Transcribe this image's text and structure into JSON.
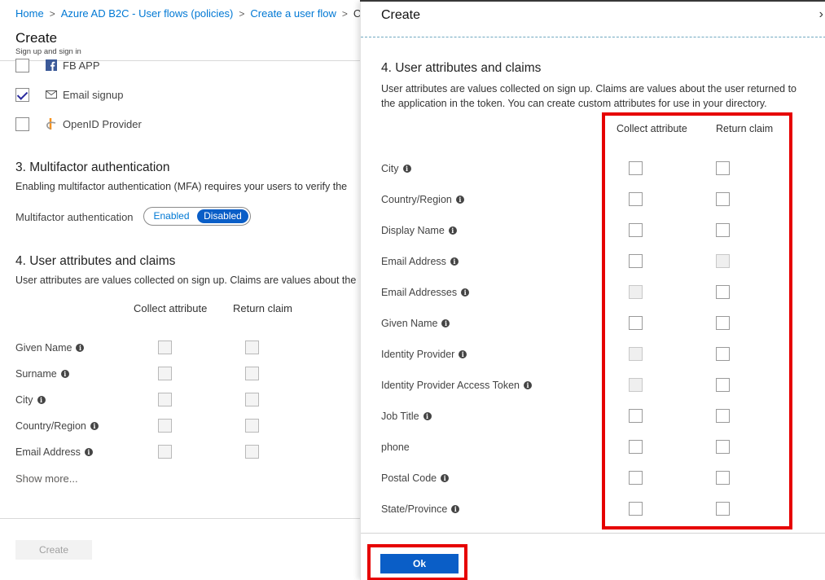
{
  "breadcrumb": {
    "items": [
      "Home",
      "Azure AD B2C - User flows (policies)",
      "Create a user flow",
      "Cre"
    ],
    "separator": ">"
  },
  "blade": {
    "title": "Create",
    "subtitle": "Sign up and sign in"
  },
  "identity_providers": [
    {
      "label": "FB APP",
      "checked": false,
      "icon": "facebook-icon"
    },
    {
      "label": "Email signup",
      "checked": true,
      "icon": "mail-icon"
    },
    {
      "label": "OpenID Provider",
      "checked": false,
      "icon": "openid-icon"
    }
  ],
  "mfa": {
    "heading": "3. Multifactor authentication",
    "description": "Enabling multifactor authentication (MFA) requires your users to verify the",
    "label": "Multifactor authentication",
    "options": [
      "Enabled",
      "Disabled"
    ],
    "selected": "Disabled"
  },
  "left_claims": {
    "heading": "4. User attributes and claims",
    "description": "User attributes are values collected on sign up. Claims are values about the",
    "collect_header": "Collect attribute",
    "return_header": "Return claim",
    "attributes": [
      "Given Name",
      "Surname",
      "City",
      "Country/Region",
      "Email Address"
    ],
    "show_more": "Show more...",
    "create_button": "Create"
  },
  "panel": {
    "title": "Create",
    "close_glyph": "›",
    "section_heading": "4. User attributes and claims",
    "description": "User attributes are values collected on sign up. Claims are values about the user returned to the application in the token. You can create custom attributes for use in your directory.",
    "collect_header": "Collect attribute",
    "return_header": "Return claim",
    "attributes": [
      {
        "name": "City",
        "info": true,
        "collect_disabled": false,
        "return_disabled": false
      },
      {
        "name": "Country/Region",
        "info": true,
        "collect_disabled": false,
        "return_disabled": false
      },
      {
        "name": "Display Name",
        "info": true,
        "collect_disabled": false,
        "return_disabled": false
      },
      {
        "name": "Email Address",
        "info": true,
        "collect_disabled": false,
        "return_disabled": true
      },
      {
        "name": "Email Addresses",
        "info": true,
        "collect_disabled": true,
        "return_disabled": false
      },
      {
        "name": "Given Name",
        "info": true,
        "collect_disabled": false,
        "return_disabled": false
      },
      {
        "name": "Identity Provider",
        "info": true,
        "collect_disabled": true,
        "return_disabled": false
      },
      {
        "name": "Identity Provider Access Token",
        "info": true,
        "collect_disabled": true,
        "return_disabled": false
      },
      {
        "name": "Job Title",
        "info": true,
        "collect_disabled": false,
        "return_disabled": false
      },
      {
        "name": "phone",
        "info": false,
        "collect_disabled": false,
        "return_disabled": false
      },
      {
        "name": "Postal Code",
        "info": true,
        "collect_disabled": false,
        "return_disabled": false
      },
      {
        "name": "State/Province",
        "info": true,
        "collect_disabled": false,
        "return_disabled": false
      }
    ],
    "ok_button": "Ok"
  },
  "colors": {
    "link": "#0078d4",
    "primary_button": "#0a5ec7",
    "highlight": "#e60000"
  }
}
